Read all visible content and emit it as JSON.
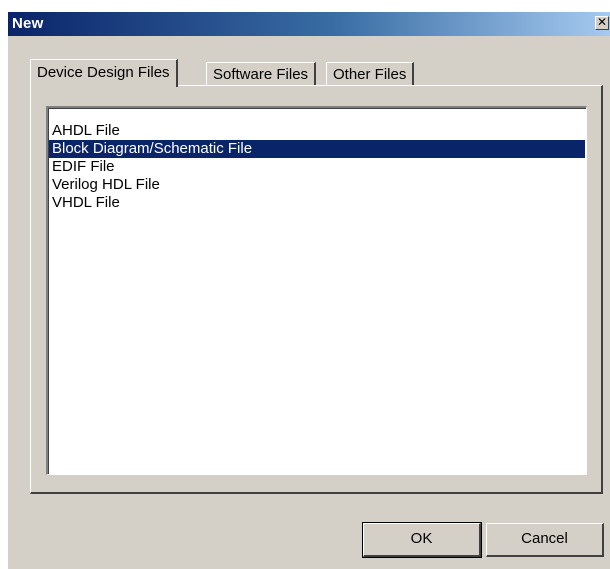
{
  "window": {
    "title": "New",
    "close_glyph": "✕"
  },
  "tabs": [
    {
      "label": "Device Design Files",
      "active": true
    },
    {
      "label": "Software Files",
      "active": false
    },
    {
      "label": "Other Files",
      "active": false
    }
  ],
  "file_types": {
    "items": [
      {
        "label": "AHDL File",
        "selected": false
      },
      {
        "label": "Block Diagram/Schematic File",
        "selected": true
      },
      {
        "label": "EDIF File",
        "selected": false
      },
      {
        "label": "Verilog HDL File",
        "selected": false
      },
      {
        "label": "VHDL File",
        "selected": false
      }
    ]
  },
  "buttons": {
    "ok_label": "OK",
    "cancel_label": "Cancel"
  },
  "colors": {
    "title_bar": "#0a246a",
    "face": "#d4d0c8",
    "selection": "#0a246a"
  }
}
